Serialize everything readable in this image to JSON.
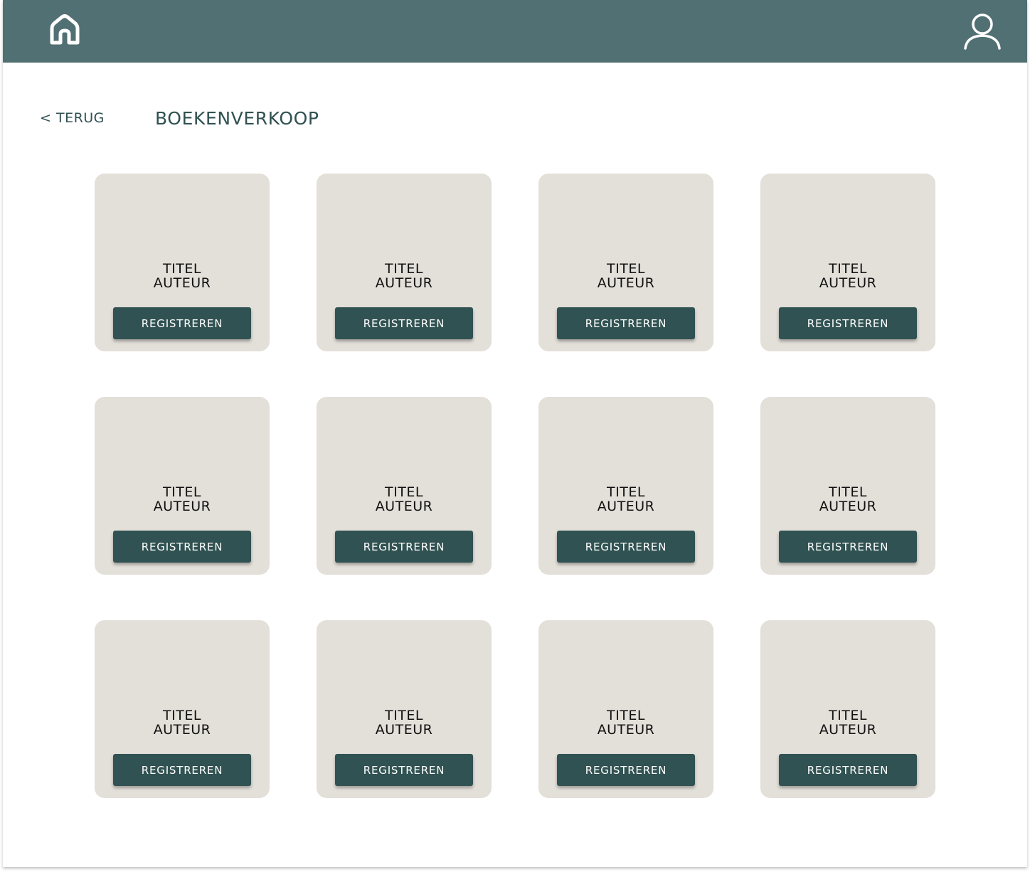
{
  "header": {
    "home_icon": "home-icon",
    "user_icon": "user-icon",
    "bar_color": "#517073"
  },
  "nav": {
    "back_label": "< TERUG",
    "page_title": "BOEKENVERKOOP"
  },
  "colors": {
    "card_background": "#e3dfd9",
    "button_background": "#315252",
    "title_color": "#2f5150"
  },
  "books": [
    {
      "title": "TITEL",
      "author": "AUTEUR",
      "button_label": "REGISTREREN"
    },
    {
      "title": "TITEL",
      "author": "AUTEUR",
      "button_label": "REGISTREREN"
    },
    {
      "title": "TITEL",
      "author": "AUTEUR",
      "button_label": "REGISTREREN"
    },
    {
      "title": "TITEL",
      "author": "AUTEUR",
      "button_label": "REGISTREREN"
    },
    {
      "title": "TITEL",
      "author": "AUTEUR",
      "button_label": "REGISTREREN"
    },
    {
      "title": "TITEL",
      "author": "AUTEUR",
      "button_label": "REGISTREREN"
    },
    {
      "title": "TITEL",
      "author": "AUTEUR",
      "button_label": "REGISTREREN"
    },
    {
      "title": "TITEL",
      "author": "AUTEUR",
      "button_label": "REGISTREREN"
    },
    {
      "title": "TITEL",
      "author": "AUTEUR",
      "button_label": "REGISTREREN"
    },
    {
      "title": "TITEL",
      "author": "AUTEUR",
      "button_label": "REGISTREREN"
    },
    {
      "title": "TITEL",
      "author": "AUTEUR",
      "button_label": "REGISTREREN"
    },
    {
      "title": "TITEL",
      "author": "AUTEUR",
      "button_label": "REGISTREREN"
    }
  ]
}
